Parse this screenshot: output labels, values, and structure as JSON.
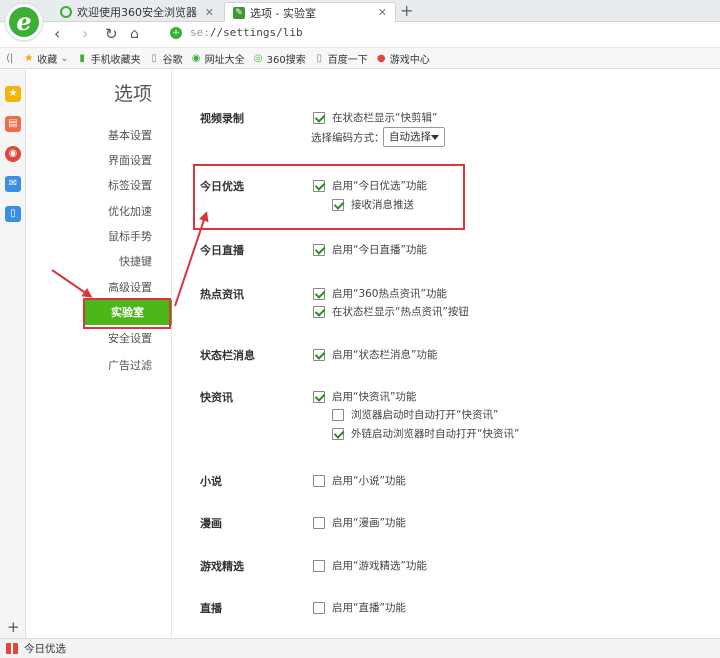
{
  "tabs": [
    {
      "label": "欢迎使用360安全浏览器"
    },
    {
      "label": "选项 - 实验室"
    }
  ],
  "navbar": {
    "address_scheme": "se:",
    "address_path": "//settings/lib"
  },
  "bookmarks": [
    {
      "label": "收藏",
      "icon": "star-icon",
      "color": "#f0a30a"
    },
    {
      "label": "手机收藏夹",
      "icon": "phone-icon",
      "color": "#3cb034"
    },
    {
      "label": "谷歌",
      "icon": "page-icon",
      "color": "#888888"
    },
    {
      "label": "网址大全",
      "icon": "globe-icon",
      "color": "#3cb034"
    },
    {
      "label": "360搜索",
      "icon": "search360-icon",
      "color": "#3cb034"
    },
    {
      "label": "百度一下",
      "icon": "page-icon",
      "color": "#888888"
    },
    {
      "label": "游戏中心",
      "icon": "game-icon",
      "color": "#e0463b"
    }
  ],
  "settings": {
    "title": "选项",
    "nav": [
      {
        "label": "基本设置"
      },
      {
        "label": "界面设置"
      },
      {
        "label": "标签设置"
      },
      {
        "label": "优化加速"
      },
      {
        "label": "鼠标手势"
      },
      {
        "label": "快捷键"
      },
      {
        "label": "高级设置"
      },
      {
        "label": "实验室",
        "active": true
      },
      {
        "label": "安全设置"
      },
      {
        "label": "广告过滤"
      }
    ]
  },
  "content": {
    "sections": [
      {
        "label": "视频录制",
        "options": [
          {
            "text": "在状态栏显示“快剪辑”",
            "checked": true
          }
        ],
        "select_label": "选择编码方式：",
        "select_value": "自动选择"
      },
      {
        "label": "今日优选",
        "options": [
          {
            "text": "启用“今日优选”功能",
            "checked": true
          },
          {
            "text": "接收消息推送",
            "checked": true
          }
        ]
      },
      {
        "label": "今日直播",
        "options": [
          {
            "text": "启用“今日直播”功能",
            "checked": true
          }
        ]
      },
      {
        "label": "热点资讯",
        "options": [
          {
            "text": "启用“360热点资讯”功能",
            "checked": true
          },
          {
            "text": "在状态栏显示“热点资讯”按钮",
            "checked": true
          }
        ]
      },
      {
        "label": "状态栏消息",
        "options": [
          {
            "text": "启用“状态栏消息”功能",
            "checked": true
          }
        ]
      },
      {
        "label": "快资讯",
        "options": [
          {
            "text": "启用“快资讯”功能",
            "checked": true
          },
          {
            "text": "浏览器启动时自动打开“快资讯”",
            "checked": false
          },
          {
            "text": "外链启动浏览器时自动打开“快资讯”",
            "checked": true
          }
        ]
      },
      {
        "label": "小说",
        "options": [
          {
            "text": "启用“小说”功能",
            "checked": false
          }
        ]
      },
      {
        "label": "漫画",
        "options": [
          {
            "text": "启用“漫画”功能",
            "checked": false
          }
        ]
      },
      {
        "label": "游戏精选",
        "options": [
          {
            "text": "启用“游戏精选”功能",
            "checked": false
          }
        ]
      },
      {
        "label": "直播",
        "options": [
          {
            "text": "启用“直播”功能",
            "checked": false
          }
        ]
      }
    ]
  },
  "statusbar": {
    "text": "今日优选"
  },
  "colors": {
    "accent_green": "#4cb71a",
    "annotation_red": "#d9363e"
  }
}
